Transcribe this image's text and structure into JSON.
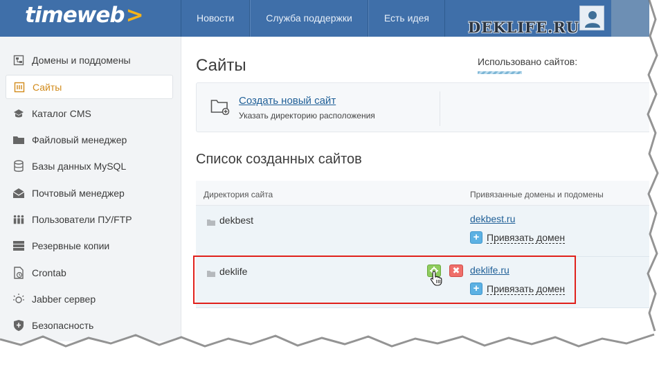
{
  "header": {
    "logo_text": "timeweb",
    "logo_arrow": ">",
    "nav": [
      {
        "label": "Новости"
      },
      {
        "label": "Служба поддержки"
      },
      {
        "label": "Есть идея"
      }
    ],
    "watermark": "DEKLIFE.RU"
  },
  "sidebar": {
    "items": [
      {
        "label": "Домены и поддомены",
        "icon": "domains-icon"
      },
      {
        "label": "Сайты",
        "icon": "sites-icon",
        "active": true
      },
      {
        "label": "Каталог CMS",
        "icon": "cms-icon"
      },
      {
        "label": "Файловый менеджер",
        "icon": "folder-icon"
      },
      {
        "label": "Базы данных MySQL",
        "icon": "database-icon"
      },
      {
        "label": "Почтовый менеджер",
        "icon": "mail-icon"
      },
      {
        "label": "Пользователи ПУ/FTP",
        "icon": "users-icon"
      },
      {
        "label": "Резервные копии",
        "icon": "backup-icon"
      },
      {
        "label": "Crontab",
        "icon": "crontab-icon"
      },
      {
        "label": "Jabber сервер",
        "icon": "jabber-icon"
      },
      {
        "label": "Безопасность",
        "icon": "shield-icon"
      }
    ]
  },
  "main": {
    "title": "Сайты",
    "used_label": "Использовано сайтов:",
    "create": {
      "link": "Создать новый сайт",
      "hint": "Указать директорию расположения"
    },
    "list_title": "Список созданных сайтов",
    "table": {
      "headers": [
        "Директория сайта",
        "Привязанные домены и подомены"
      ],
      "rows": [
        {
          "dir": "dekbest",
          "domain": "dekbest.ru",
          "bind_label": "Привязать домен"
        },
        {
          "dir": "deklife",
          "domain": "deklife.ru",
          "bind_label": "Привязать домен"
        }
      ]
    }
  },
  "colors": {
    "topbar": "#3f6fa9",
    "accent_active": "#d28a1a",
    "link": "#1f5f97",
    "highlight": "#e0201b"
  }
}
